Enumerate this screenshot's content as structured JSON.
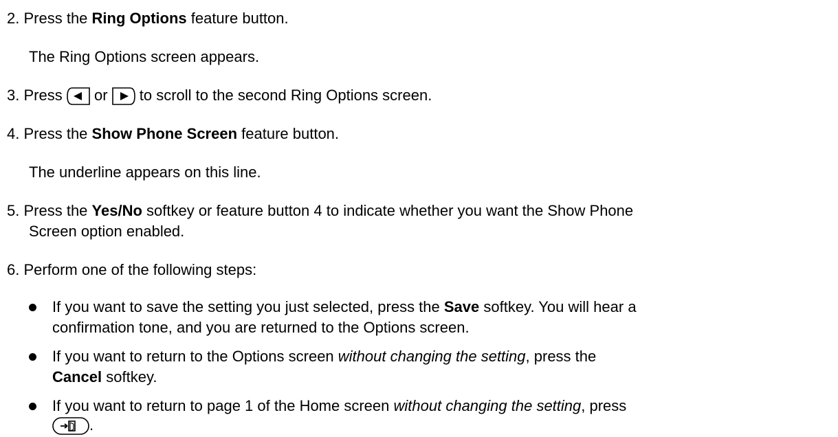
{
  "steps": [
    {
      "num": "2.",
      "pre": "Press the ",
      "bold": "Ring Options",
      "post": " feature button."
    },
    {
      "note": "The Ring Options screen appears."
    },
    {
      "num": "3.",
      "pre": "Press ",
      "mid": " or ",
      "post": " to scroll to the second Ring Options screen.",
      "icons": [
        "scroll-left-icon",
        "scroll-right-icon"
      ]
    },
    {
      "num": "4.",
      "pre": "Press the ",
      "bold": "Show Phone Screen",
      "post": " feature button."
    },
    {
      "note": "The underline appears on this line."
    },
    {
      "num": "5.",
      "pre": "Press the ",
      "bold": "Yes/No",
      "post": " softkey or feature button 4 to indicate whether you want the Show Phone",
      "cont": "Screen option enabled."
    },
    {
      "num": "6.",
      "text": "Perform one of the following steps:"
    }
  ],
  "bullets": [
    {
      "pre": "If you want to save the setting you just selected, press the ",
      "bold": "Save",
      "post": " softkey. You will hear a",
      "cont": "confirmation tone, and you are returned to the Options screen."
    },
    {
      "pre": "If you want to return to the Options screen ",
      "italic": "without changing the setting",
      "post": ", press the",
      "cont_bold": "Cancel",
      "cont_post": " softkey."
    },
    {
      "pre": "If you want to return to page 1 of the Home screen ",
      "italic": "without changing the setting",
      "post": ", press",
      "cont_post": ".",
      "icon": "exit-icon"
    }
  ]
}
